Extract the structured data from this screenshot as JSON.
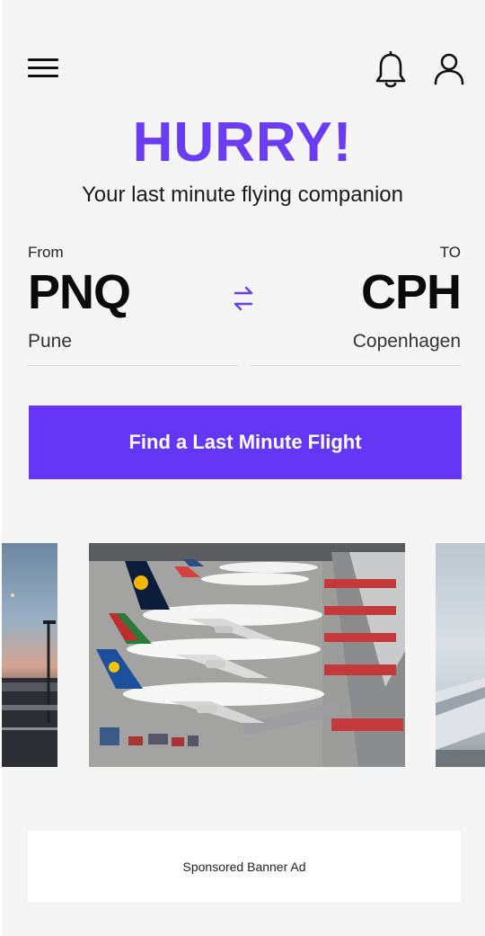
{
  "header": {
    "menu_icon": "hamburger-menu-icon",
    "notification_icon": "bell-icon",
    "profile_icon": "user-icon"
  },
  "hero": {
    "title": "HURRY!",
    "subtitle": "Your last minute flying companion",
    "accent_color": "#6a3df3"
  },
  "route": {
    "from": {
      "label": "From",
      "code": "PNQ",
      "city": "Pune"
    },
    "to": {
      "label": "TO",
      "code": "CPH",
      "city": "Copenhagen"
    },
    "swap_icon": "swap-arrows-icon"
  },
  "cta": {
    "label": "Find a Last Minute Flight",
    "color": "#6436f5"
  },
  "carousel": {
    "images": [
      {
        "name": "airport-dusk-photo"
      },
      {
        "name": "airport-gates-planes-photo",
        "tail_labels": [
          "Lufthansa",
          "SriLankan",
          "Condor"
        ]
      },
      {
        "name": "airplane-wing-sky-photo"
      }
    ]
  },
  "ad": {
    "label": "Sponsored Banner Ad"
  }
}
